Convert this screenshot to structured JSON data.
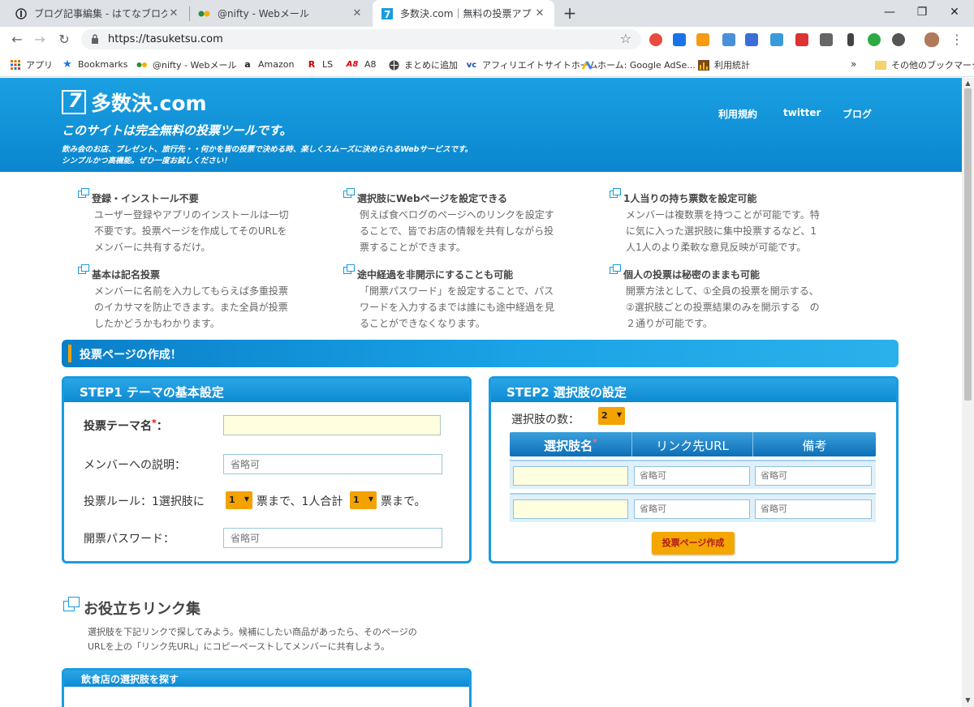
{
  "browser": {
    "tabs": [
      {
        "title": "ブログ記事編集 - はてなブログ",
        "active": false
      },
      {
        "title": "@nifty - Webメール",
        "active": false
      },
      {
        "title": "多数決.com｜無料の投票アプリ·者",
        "active": true
      }
    ],
    "new_tab": "+",
    "url": "https://tasuketsu.com",
    "bookmarks": [
      {
        "label": "アプリ",
        "icon": "apps-grid-icon"
      },
      {
        "label": "Bookmarks",
        "icon": "star-icon"
      },
      {
        "label": "@nifty - Webメール",
        "icon": "nifty-icon"
      },
      {
        "label": "Amazon",
        "icon": "amazon-icon"
      },
      {
        "label": "LS",
        "icon": "ls-icon"
      },
      {
        "label": "A8",
        "icon": "a8-icon"
      },
      {
        "label": "まとめに追加",
        "icon": "globe-icon"
      },
      {
        "label": "アフィリエイトサイトホーム",
        "icon": "vc-icon"
      },
      {
        "label": "ホーム: Google AdSe...",
        "icon": "adsense-icon"
      },
      {
        "label": "利用統計",
        "icon": "stats-icon"
      }
    ],
    "bookmarks_more": "»",
    "other_bookmarks": "その他のブックマーク"
  },
  "site": {
    "logo_text": "多数決.com",
    "tagline": "このサイトは完全無料の投票ツールです。",
    "subtag_1": "飲み会のお店、プレゼント、旅行先・・何かを皆の投票で決める時、楽しくスムーズに決められるWebサービスです。",
    "subtag_2": "シンプルかつ高機能。ぜひ一度お試しください！",
    "nav": [
      "利用規約",
      "twitter",
      "ブログ"
    ]
  },
  "features": [
    {
      "title": "登録・インストール不要",
      "lines": [
        "ユーザー登録やアプリのインストールは一切",
        "不要です。投票ページを作成してそのURLを",
        "メンバーに共有するだけ。"
      ]
    },
    {
      "title": "選択肢にWebページを設定できる",
      "lines": [
        "例えば食べログのページへのリンクを設定す",
        "ることで、皆でお店の情報を共有しながら投",
        "票することができます。"
      ]
    },
    {
      "title": "1人当りの持ち票数を設定可能",
      "lines": [
        "メンバーは複数票を持つことが可能です。特",
        "に気に入った選択肢に集中投票するなど、1",
        "人1人のより柔軟な意見反映が可能です。"
      ]
    },
    {
      "title": "基本は記名投票",
      "lines": [
        "メンバーに名前を入力してもらえば多重投票",
        "のイカサマを防止できます。また全員が投票",
        "したかどうかもわかります。"
      ]
    },
    {
      "title": "途中経過を非開示にすることも可能",
      "lines": [
        "「開票パスワード」を設定することで、パス",
        "ワードを入力するまでは誰にも途中経過を見",
        "ることができなくなります。"
      ]
    },
    {
      "title": "個人の投票は秘密のままも可能",
      "lines": [
        "開票方法として、①全員の投票を開示する、",
        "②選択肢ごとの投票結果のみを開示する　の",
        "２通りが可能です。"
      ]
    }
  ],
  "create_section": {
    "title": "投票ページの作成！"
  },
  "step1": {
    "title": "STEP1 テーマの基本設定",
    "theme_label": "投票テーマ名",
    "required_mark": "*",
    "theme_colon": "：",
    "theme_value": "",
    "desc_label": "メンバーへの説明：",
    "desc_placeholder": "省略可",
    "rule_prefix": "投票ルール：1選択肢に",
    "rule_per_choice": "1",
    "rule_middle": "票まで、1人合計",
    "rule_total": "1",
    "rule_suffix": "票まで。",
    "password_label": "開票パスワード：",
    "password_placeholder": "省略可"
  },
  "step2": {
    "title": "STEP2 選択肢の設定",
    "count_label": "選択肢の数：",
    "count_value": "2",
    "headers": [
      "選択肢名",
      "リンク先URL",
      "備考"
    ],
    "required_mark": "*",
    "rows": [
      {
        "name": "",
        "url_placeholder": "省略可",
        "note_placeholder": "省略可"
      },
      {
        "name": "",
        "url_placeholder": "省略可",
        "note_placeholder": "省略可"
      }
    ],
    "create_button": "投票ページ作成"
  },
  "links": {
    "title": "お役立ちリンク集",
    "desc_1": "選択肢を下記リンクで探してみよう。候補にしたい商品があったら、そのページの",
    "desc_2": "URLを上の「リンク先URL」にコピーペーストしてメンバーに共有しよう。",
    "food_title": "飲食店の選択肢を探す"
  },
  "colors": {
    "brand_blue": "#1a9be0",
    "accent_orange": "#f3a200",
    "input_yellow": "#ffffe0"
  }
}
